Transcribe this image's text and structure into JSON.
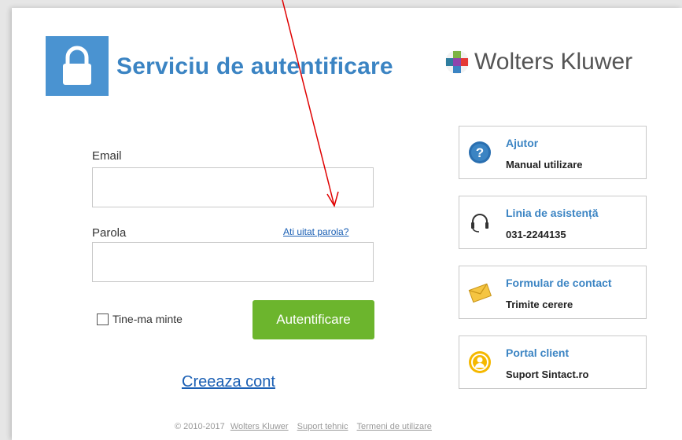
{
  "header": {
    "title": "Serviciu de autentificare",
    "brand_name": "Wolters Kluwer",
    "lock_color": "#4a93d1"
  },
  "form": {
    "email_label": "Email",
    "email_value": "",
    "password_label": "Parola",
    "password_value": "",
    "forgot_link": "Ati uitat parola?",
    "remember_label": "Tine-ma minte",
    "remember_checked": false,
    "submit_label": "Autentificare",
    "create_account": "Creeaza cont"
  },
  "help_boxes": [
    {
      "title": "Ajutor",
      "subtitle": "Manual utilizare",
      "icon": "question-circle-icon"
    },
    {
      "title": "Linia de asistență",
      "subtitle": "031-2244135",
      "icon": "headset-icon"
    },
    {
      "title": "Formular de contact",
      "subtitle": "Trimite cerere",
      "icon": "envelope-icon"
    },
    {
      "title": "Portal client",
      "subtitle": "Suport Sintact.ro",
      "icon": "user-portal-icon"
    }
  ],
  "footer": {
    "copyright": "© 2010-2017",
    "links": [
      "Wolters Kluwer",
      "Suport tehnic",
      "Termeni de utilizare"
    ]
  },
  "colors": {
    "accent_blue": "#3b84c3",
    "button_green": "#6cb52d",
    "link_blue": "#1a5fb4",
    "annotation_arrow": "#e00000"
  }
}
